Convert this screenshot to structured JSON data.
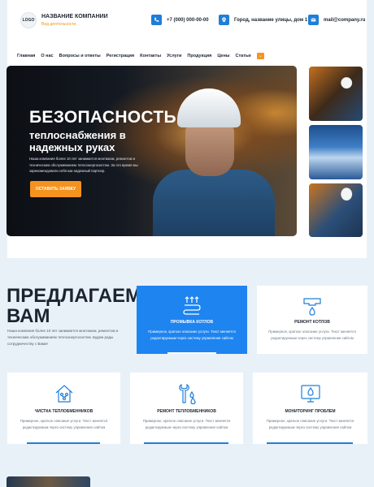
{
  "header": {
    "logo_text": "LOGO",
    "company_name": "НАЗВАНИЕ КОМПАНИИ",
    "company_sub": "Вид деятельности",
    "phone": "+7 (000) 000-00-00",
    "address": "Город, название улицы, дом 1",
    "email": "mail@company.ru",
    "icons": [
      "phone-icon",
      "location-icon",
      "mail-icon"
    ]
  },
  "nav": {
    "items": [
      "Главная",
      "О нас",
      "Вопросы и ответы",
      "Регистрация",
      "Контакты",
      "Услуги",
      "Продукция",
      "Цены",
      "Статьи"
    ],
    "more_label": "⌄"
  },
  "hero": {
    "title": "БЕЗОПАСНОСТЬ",
    "subtitle_line1": "теплоснабжения в",
    "subtitle_line2": "надежных руках",
    "text": "Наша компания более 10 лет занимается монтажом, ремонтом и техническим обслуживанием теплоэнергосистем. За это время мы зарекомендовали себя как надежный партнер.",
    "button_label": "ОСТАВИТЬ ЗАЯВКУ"
  },
  "services": {
    "title_line1": "ПРЕДЛАГАЕМ",
    "title_line2": "ВАМ",
    "text": "Наша компания более 10 лет занимается монтажом, ремонтом и техническим обслуживанием теплоэнергосистем. Будем рады сотрудничеству с Вами!",
    "cards": [
      {
        "title": "ПРОМЫВКА КОТЛОВ",
        "desc": "Примерное, краткое описание услуги. Текст меняется редактируемым через систему управления сайтом",
        "icon": "heat-pipe-icon"
      },
      {
        "title": "РЕМОНТ КОТЛОВ",
        "desc": "Примерное, краткое описание услуги. Текст меняется редактируемым через систему управления сайтом",
        "icon": "pipe-drop-icon"
      },
      {
        "title": "ЧИСТКА ТЕПЛОБМЕННИКОВ",
        "desc": "Примерное, краткое описание услуги. Текст меняется редактируемым через систему управления сайтом",
        "icon": "house-network-icon"
      },
      {
        "title": "РЕМОНТ ТЕПЛОБМЕННИКОВ",
        "desc": "Примерное, краткое описание услуги. Текст меняется редактируемым через систему управления сайтом",
        "icon": "wrench-drops-icon"
      },
      {
        "title": "МОНИТОРИНГ ПРОБЛЕМ",
        "desc": "Примерное, краткое описание услуги. Текст меняется редактируемым через систему управления сайтом",
        "icon": "monitor-drop-icon"
      }
    ]
  },
  "colors": {
    "accent": "#f5931e",
    "brand_blue": "#1e84f0",
    "background": "#e9f1f8"
  }
}
